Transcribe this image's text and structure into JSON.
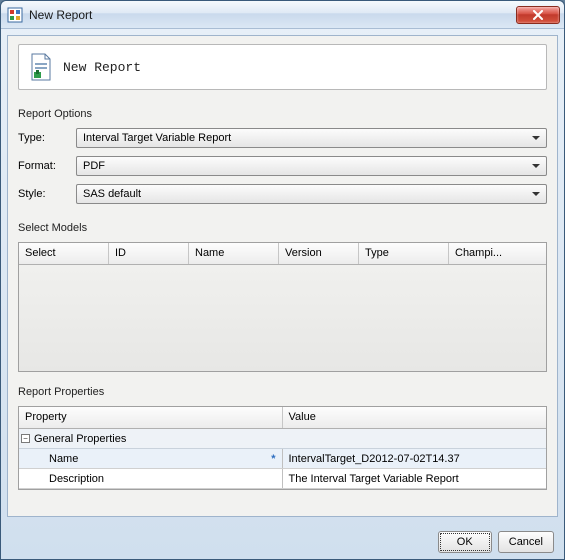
{
  "window": {
    "title": "New Report"
  },
  "header": {
    "title": "New Report"
  },
  "sections": {
    "options_label": "Report Options",
    "models_label": "Select Models",
    "properties_label": "Report Properties"
  },
  "options": {
    "type_label": "Type:",
    "type_value": "Interval Target Variable Report",
    "format_label": "Format:",
    "format_value": "PDF",
    "style_label": "Style:",
    "style_value": "SAS default"
  },
  "models": {
    "columns": [
      "Select",
      "ID",
      "Name",
      "Version",
      "Type",
      "Champi..."
    ]
  },
  "properties": {
    "columns": {
      "property": "Property",
      "value": "Value"
    },
    "group_label": "General Properties",
    "rows": [
      {
        "name": "Name",
        "required": true,
        "value": "IntervalTarget_D2012-07-02T14.37"
      },
      {
        "name": "Description",
        "required": false,
        "value": "The Interval Target Variable Report"
      }
    ],
    "collapse_glyph": "−",
    "star_glyph": "*"
  },
  "buttons": {
    "ok": "OK",
    "cancel": "Cancel"
  }
}
